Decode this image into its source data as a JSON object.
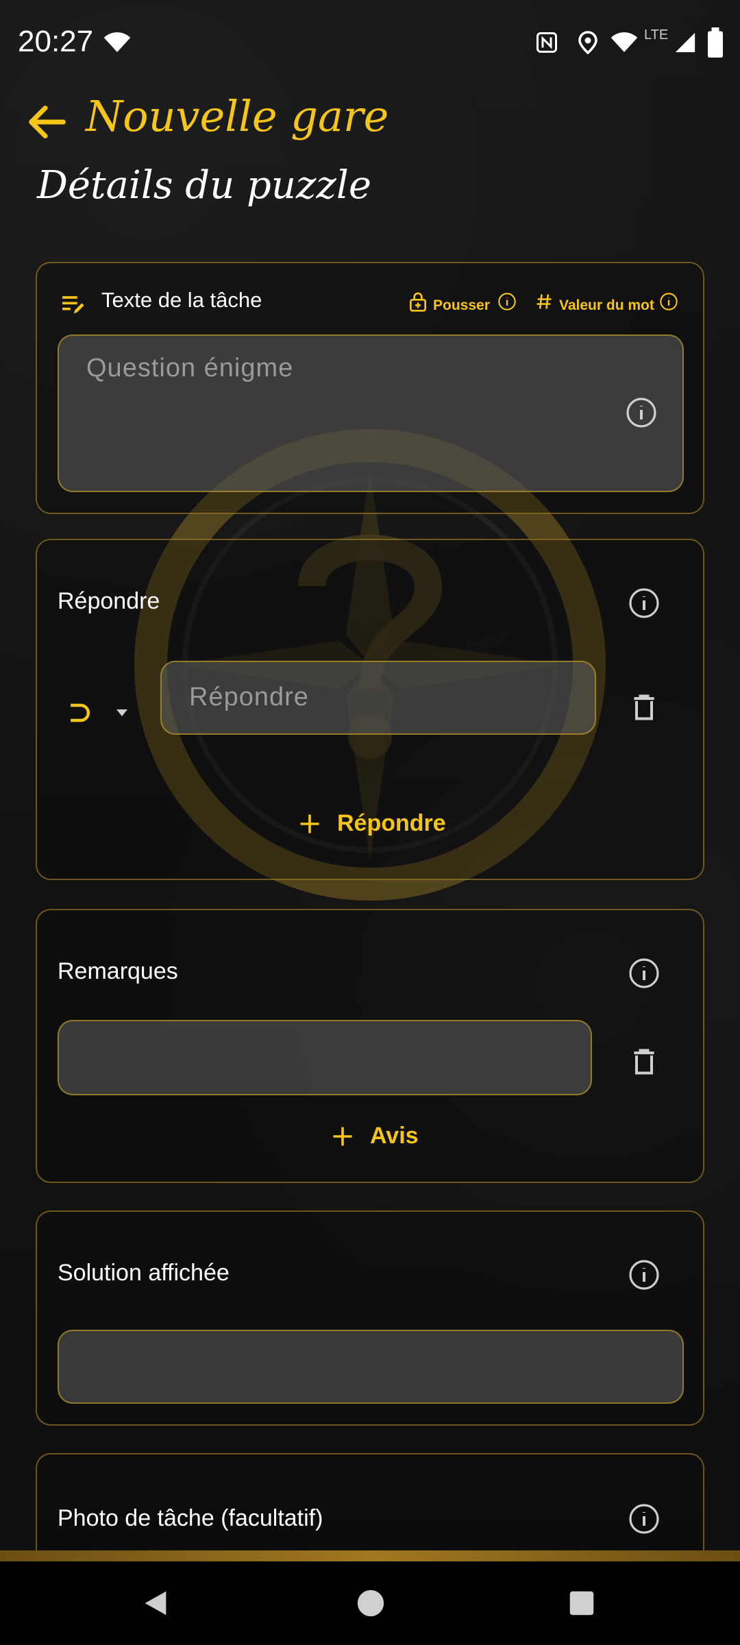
{
  "status_bar": {
    "time": "20:27",
    "network": "LTE"
  },
  "app_bar": {
    "title": "Nouvelle gare"
  },
  "page": {
    "subtitle": "Détails du puzzle"
  },
  "task_card": {
    "label": "Texte de la tâche",
    "push_label": "Pousser",
    "word_value_label": "Valeur du mot",
    "placeholder": "Question énigme"
  },
  "answer_card": {
    "label": "Répondre",
    "answer_placeholder": "Répondre",
    "add_label": "Répondre"
  },
  "remarks_card": {
    "label": "Remarques",
    "add_label": "Avis"
  },
  "solution_card": {
    "label": "Solution affichée"
  },
  "photo_card": {
    "label": "Photo de tâche (facultatif)"
  },
  "colors": {
    "accent": "#f5c518",
    "border": "#ba9628",
    "field": "#5f5f5f"
  },
  "icons": {
    "back": "arrow-left-icon",
    "task": "edit-note-icon",
    "lock": "lock-icon",
    "hash": "hash-icon",
    "info": "info-icon",
    "operator": "superset-icon",
    "dropdown": "caret-down-icon",
    "delete": "trash-icon",
    "add": "plus-icon"
  }
}
